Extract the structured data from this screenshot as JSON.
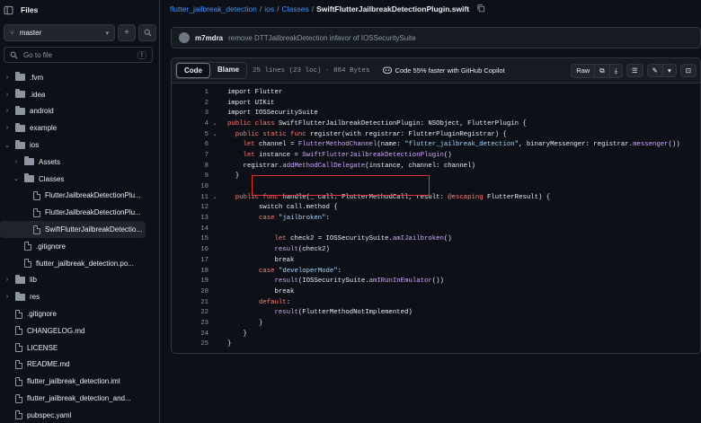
{
  "sidebar": {
    "title": "Files",
    "branch": "master",
    "goto_placeholder": "Go to file",
    "goto_shortcut": "t",
    "items": [
      {
        "label": ".fvm",
        "type": "folder",
        "indent": 0,
        "chevron": "›"
      },
      {
        "label": ".idea",
        "type": "folder",
        "indent": 0,
        "chevron": "›"
      },
      {
        "label": "android",
        "type": "folder",
        "indent": 0,
        "chevron": "›"
      },
      {
        "label": "example",
        "type": "folder",
        "indent": 0,
        "chevron": "›"
      },
      {
        "label": "ios",
        "type": "folder",
        "indent": 0,
        "chevron": "⌄"
      },
      {
        "label": "Assets",
        "type": "folder",
        "indent": 1,
        "chevron": "›"
      },
      {
        "label": "Classes",
        "type": "folder",
        "indent": 1,
        "chevron": "⌄"
      },
      {
        "label": "FlutterJailbreakDetectionPlu...",
        "type": "file",
        "indent": 2,
        "chevron": ""
      },
      {
        "label": "FlutterJailbreakDetectionPlu...",
        "type": "file",
        "indent": 2,
        "chevron": ""
      },
      {
        "label": "SwiftFlutterJailbreakDetectio...",
        "type": "file",
        "indent": 2,
        "chevron": "",
        "selected": true
      },
      {
        "label": ".gitignore",
        "type": "file",
        "indent": 1,
        "chevron": ""
      },
      {
        "label": "flutter_jailbreak_detection.po...",
        "type": "file",
        "indent": 1,
        "chevron": ""
      },
      {
        "label": "lib",
        "type": "folder",
        "indent": 0,
        "chevron": "›"
      },
      {
        "label": "res",
        "type": "folder",
        "indent": 0,
        "chevron": "›"
      },
      {
        "label": ".gitignore",
        "type": "file",
        "indent": 0,
        "chevron": ""
      },
      {
        "label": "CHANGELOG.md",
        "type": "file",
        "indent": 0,
        "chevron": ""
      },
      {
        "label": "LICENSE",
        "type": "file",
        "indent": 0,
        "chevron": ""
      },
      {
        "label": "README.md",
        "type": "file",
        "indent": 0,
        "chevron": ""
      },
      {
        "label": "flutter_jailbreak_detection.iml",
        "type": "file",
        "indent": 0,
        "chevron": ""
      },
      {
        "label": "flutter_jailbreak_detection_and...",
        "type": "file",
        "indent": 0,
        "chevron": ""
      },
      {
        "label": "pubspec.yaml",
        "type": "file",
        "indent": 0,
        "chevron": ""
      }
    ]
  },
  "breadcrumb": {
    "repo": "flutter_jailbreak_detection",
    "dir1": "ios",
    "dir2": "Classes",
    "file": "SwiftFlutterJailbreakDetectionPlugin.swift",
    "sep": "/"
  },
  "commit": {
    "author": "m7mdra",
    "message": "remove DTTJailbreakDetection infavor of IOSSecuritySuite"
  },
  "toolbar": {
    "code_tab": "Code",
    "blame_tab": "Blame",
    "meta": "25 lines (23 loc) · 884 Bytes",
    "copilot": "Code 55% faster with GitHub Copilot",
    "raw": "Raw"
  },
  "code_lines": [
    {
      "n": "1",
      "fold": "",
      "html": "import Flutter"
    },
    {
      "n": "2",
      "fold": "",
      "html": "import UIKit"
    },
    {
      "n": "3",
      "fold": "",
      "html": "import IOSSecuritySuite"
    },
    {
      "n": "4",
      "fold": "⌄",
      "html": "<span class='kw'>public class</span> SwiftFlutterJailbreakDetectionPlugin: NSObject, FlutterPlugin {"
    },
    {
      "n": "5",
      "fold": "⌄",
      "html": "  <span class='kw'>public static func</span> register(with registrar: FlutterPluginRegistrar) {"
    },
    {
      "n": "6",
      "fold": "",
      "html": "    <span class='kw'>let</span> channel = <span class='fn'>FlutterMethodChannel</span>(name: <span class='str'>\"flutter_jailbreak_detection\"</span>, binaryMessenger: registrar.<span class='fn'>messenger</span>())"
    },
    {
      "n": "7",
      "fold": "",
      "html": "    <span class='kw'>let</span> instance = <span class='fn'>SwiftFlutterJailbreakDetectionPlugin</span>()"
    },
    {
      "n": "8",
      "fold": "",
      "html": "    registrar.<span class='fn'>addMethodCallDelegate</span>(instance, channel: channel)"
    },
    {
      "n": "9",
      "fold": "",
      "html": "  }"
    },
    {
      "n": "10",
      "fold": "",
      "html": ""
    },
    {
      "n": "11",
      "fold": "⌄",
      "html": "  <span class='kw'>public func</span> handle(_ call: FlutterMethodCall, result: <span class='kw'>@escaping</span> FlutterResult) {"
    },
    {
      "n": "12",
      "fold": "",
      "html": "        switch call.method {"
    },
    {
      "n": "13",
      "fold": "",
      "html": "        <span class='kw'>case</span> <span class='str'>\"jailbroken\"</span>:"
    },
    {
      "n": "14",
      "fold": "",
      "html": ""
    },
    {
      "n": "15",
      "fold": "",
      "html": "            <span class='kw'>let</span> check2 = IOSSecuritySuite.<span class='fn'>amIJailbroken</span>()"
    },
    {
      "n": "16",
      "fold": "",
      "html": "            <span class='fn'>result</span>(check2)"
    },
    {
      "n": "17",
      "fold": "",
      "html": "            break"
    },
    {
      "n": "18",
      "fold": "",
      "html": "        <span class='kw'>case</span> <span class='str'>\"developerMode\"</span>:"
    },
    {
      "n": "19",
      "fold": "",
      "html": "            <span class='fn'>result</span>(IOSSecuritySuite.<span class='fn'>amIRunInEmulator</span>())"
    },
    {
      "n": "20",
      "fold": "",
      "html": "            break"
    },
    {
      "n": "21",
      "fold": "",
      "html": "        <span class='kw'>default</span>:"
    },
    {
      "n": "22",
      "fold": "",
      "html": "            <span class='fn'>result</span>(FlutterMethodNotImplemented)"
    },
    {
      "n": "23",
      "fold": "",
      "html": "        }"
    },
    {
      "n": "24",
      "fold": "",
      "html": "    }"
    },
    {
      "n": "25",
      "fold": "",
      "html": "}"
    }
  ],
  "colors": {
    "background": "#0d1117",
    "accent_link": "#4493f8",
    "keyword": "#ff7b72",
    "string": "#a5d6ff",
    "function": "#d2a8ff",
    "highlight_border": "#da3633"
  }
}
